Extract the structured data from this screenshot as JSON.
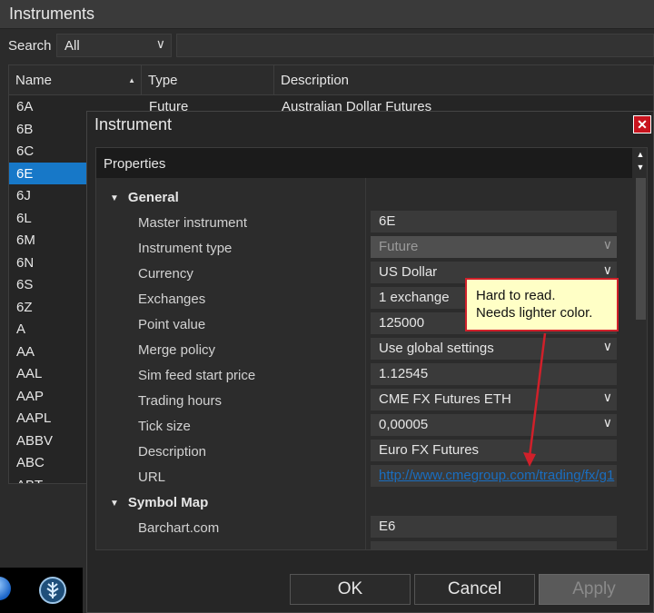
{
  "instruments_window": {
    "title": "Instruments",
    "search_label": "Search",
    "search_filter": "All",
    "columns": [
      "Name",
      "Type",
      "Description"
    ],
    "first_row": {
      "name": "6A",
      "type": "Future",
      "description": "Australian Dollar Futures"
    },
    "names": [
      "6B",
      "6C",
      "6E",
      "6J",
      "6L",
      "6M",
      "6N",
      "6S",
      "6Z",
      "A",
      "AA",
      "AAL",
      "AAP",
      "AAPL",
      "ABBV",
      "ABC",
      "ABT"
    ],
    "selected_name": "6E"
  },
  "dialog": {
    "title": "Instrument",
    "close_glyph": "✕",
    "grid_header": "Properties",
    "sections": {
      "general": "General",
      "symbol_map": "Symbol Map"
    },
    "properties": [
      {
        "label": "Master instrument",
        "value": "6E",
        "kind": "text"
      },
      {
        "label": "Instrument type",
        "value": "Future",
        "kind": "select-disabled"
      },
      {
        "label": "Currency",
        "value": "US Dollar",
        "kind": "select"
      },
      {
        "label": "Exchanges",
        "value": "1 exchange",
        "kind": "text"
      },
      {
        "label": "Point value",
        "value": "125000",
        "kind": "text"
      },
      {
        "label": "Merge policy",
        "value": "Use global settings",
        "kind": "select"
      },
      {
        "label": "Sim feed start price",
        "value": "1.12545",
        "kind": "text"
      },
      {
        "label": "Trading hours",
        "value": "CME FX Futures ETH",
        "kind": "select"
      },
      {
        "label": "Tick size",
        "value": "0,00005",
        "kind": "select"
      },
      {
        "label": "Description",
        "value": "Euro FX Futures",
        "kind": "text"
      },
      {
        "label": "URL",
        "value": "http://www.cmegroup.com/trading/fx/g1",
        "kind": "link"
      }
    ],
    "symbol_map": [
      {
        "label": "Barchart.com",
        "value": "E6"
      }
    ],
    "buttons": {
      "ok": "OK",
      "cancel": "Cancel",
      "apply": "Apply"
    }
  },
  "annotation": {
    "line1": "Hard to read.",
    "line2": "Needs lighter color.",
    "color": "#d0202a"
  },
  "colors": {
    "selection": "#1778c8",
    "link": "#1a6ec0",
    "close_button": "#c8141e"
  }
}
